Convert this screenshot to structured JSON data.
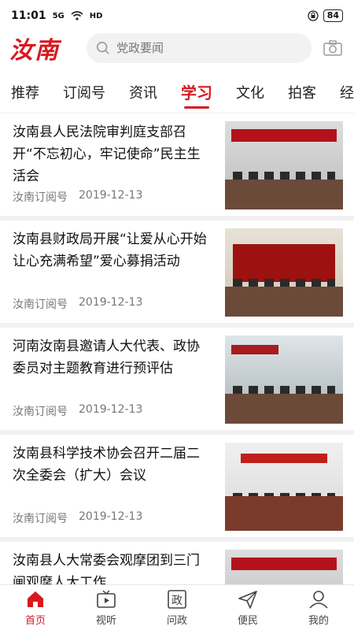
{
  "status": {
    "time": "11:01",
    "signal": "5G",
    "wifi": "HD",
    "battery": "84"
  },
  "header": {
    "logo": "汝南",
    "search_placeholder": "党政要闻"
  },
  "tabs": [
    {
      "label": "推荐"
    },
    {
      "label": "订阅号"
    },
    {
      "label": "资讯"
    },
    {
      "label": "学习",
      "active": true
    },
    {
      "label": "文化"
    },
    {
      "label": "拍客"
    },
    {
      "label": "经济"
    }
  ],
  "articles": [
    {
      "title": "汝南县人民法院审判庭支部召开“不忘初心，牢记使命”民主生活会",
      "source": "汝南订阅号",
      "date": "2019-12-13"
    },
    {
      "title": "汝南县财政局开展“让爱从心开始 让心充满希望”爱心募捐活动",
      "source": "汝南订阅号",
      "date": "2019-12-13"
    },
    {
      "title": "河南汝南县邀请人大代表、政协委员对主题教育进行预评估",
      "source": "汝南订阅号",
      "date": "2019-12-13"
    },
    {
      "title": "汝南县科学技术协会召开二届二次全委会（扩大）会议",
      "source": "汝南订阅号",
      "date": "2019-12-13"
    },
    {
      "title": "汝南县人大常委会观摩团到三门闸观摩人大工作",
      "source": "",
      "date": ""
    }
  ],
  "nav": [
    {
      "label": "首页",
      "icon": "home-icon",
      "active": true
    },
    {
      "label": "视听",
      "icon": "tv-icon"
    },
    {
      "label": "问政",
      "icon": "zheng-icon"
    },
    {
      "label": "便民",
      "icon": "send-icon"
    },
    {
      "label": "我的",
      "icon": "user-icon"
    }
  ],
  "colors": {
    "accent": "#d71920"
  }
}
